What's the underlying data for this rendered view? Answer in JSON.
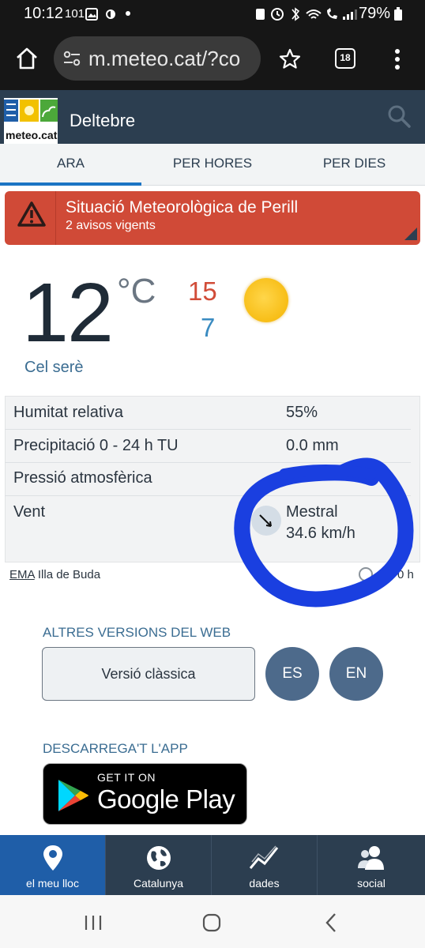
{
  "status": {
    "time": "10:12",
    "notif_count": "101",
    "battery": "79%"
  },
  "browser": {
    "url": "m.meteo.cat/?co",
    "tab_count": "18"
  },
  "app": {
    "logo_text": "meteo.cat",
    "location": "Deltebre"
  },
  "tabs": [
    {
      "label": "ARA"
    },
    {
      "label": "PER HORES"
    },
    {
      "label": "PER DIES"
    }
  ],
  "alert": {
    "title": "Situació Meteorològica de Perill",
    "subtitle": "2 avisos vigents"
  },
  "current": {
    "temp": "12",
    "unit": "°C",
    "max": "15",
    "min": "7",
    "sky": "Cel serè"
  },
  "details": [
    {
      "label": "Humitat relativa",
      "value": "55%"
    },
    {
      "label": "Precipitació 0 - 24 h TU",
      "value": "0.0 mm"
    },
    {
      "label": "Pressió atmosfèrica",
      "value": ""
    },
    {
      "label": "Vent",
      "value": "Mestral",
      "value2": "34.6 km/h"
    }
  ],
  "station": {
    "abbr": "EMA",
    "name": "Illa de Buda",
    "hour_suffix": "0 h"
  },
  "versions": {
    "title": "ALTRES VERSIONS DEL WEB",
    "classic": "Versió clàssica",
    "es": "ES",
    "en": "EN"
  },
  "app_download": {
    "title": "DESCARREGA'T L'APP",
    "badge_small": "GET IT ON",
    "badge_big": "Google Play"
  },
  "bottom_nav": [
    {
      "label": "el meu lloc"
    },
    {
      "label": "Catalunya"
    },
    {
      "label": "dades"
    },
    {
      "label": "social"
    }
  ],
  "colors": {
    "header": "#2c3e50",
    "alert": "#d04a37",
    "accent": "#1b74c4",
    "annotation": "#1a3fe0"
  }
}
